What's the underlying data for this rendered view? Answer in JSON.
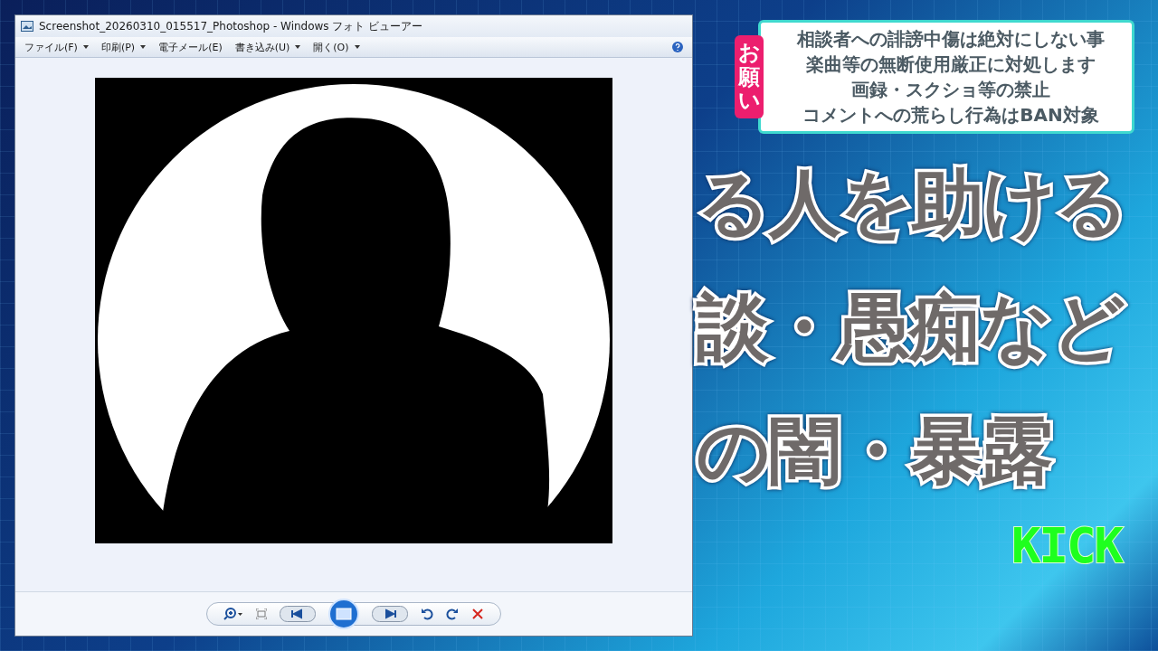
{
  "window": {
    "title": "Screenshot_20260310_015517_Photoshop - Windows フォト ビューアー",
    "menu": [
      {
        "label": "ファイル(F)",
        "dropdown": true
      },
      {
        "label": "印刷(P)",
        "dropdown": true
      },
      {
        "label": "電子メール(E)",
        "dropdown": false
      },
      {
        "label": "書き込み(U)",
        "dropdown": true
      },
      {
        "label": "開く(O)",
        "dropdown": true
      }
    ],
    "toolbar": [
      {
        "kind": "zoom"
      },
      {
        "kind": "fit"
      },
      {
        "kind": "prev"
      },
      {
        "kind": "slideshow"
      },
      {
        "kind": "next"
      },
      {
        "kind": "rotate-left"
      },
      {
        "kind": "rotate-right"
      },
      {
        "kind": "delete"
      }
    ]
  },
  "notice": {
    "tag": "お願い",
    "lines": [
      "相談者への誹謗中傷は絶対にしない事",
      "楽曲等の無断使用厳正に対処します",
      "画録・スクショ等の禁止",
      "コメントへの荒らし行為はBAN対象"
    ]
  },
  "headline": {
    "lines": [
      "る人を助ける",
      "談・愚痴など",
      "の闇・暴露"
    ]
  },
  "logo": "KICK"
}
